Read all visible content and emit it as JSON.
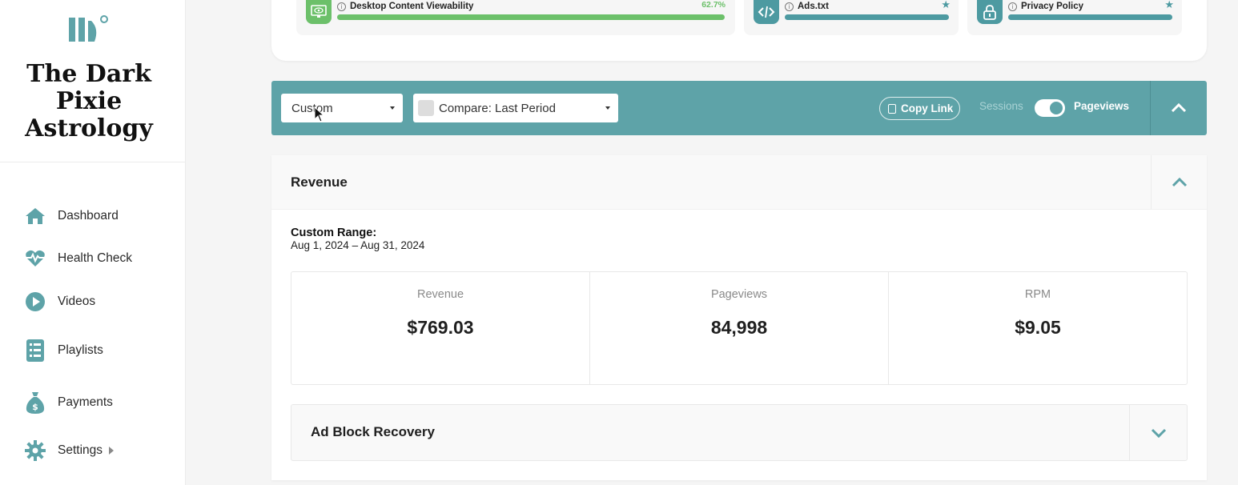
{
  "brand": {
    "site_title_lines": [
      "The Dark",
      "Pixie",
      "Astrology"
    ]
  },
  "sidebar": {
    "items": [
      {
        "label": "Dashboard",
        "icon": "home-icon"
      },
      {
        "label": "Health Check",
        "icon": "heartbeat-icon"
      },
      {
        "label": "Videos",
        "icon": "play-circle-icon"
      },
      {
        "label": "Playlists",
        "icon": "list-icon"
      },
      {
        "label": "Payments",
        "icon": "money-bag-icon"
      },
      {
        "label": "Settings",
        "icon": "gear-icon"
      }
    ]
  },
  "health_metrics": [
    {
      "label": "Desktop Content Viewability",
      "value": "62.7%",
      "progress_percent": 100,
      "icon": "monitor-eye-icon",
      "color": "#6cc06a"
    },
    {
      "label": "Ads.txt",
      "icon": "code-icon",
      "color": "#4d9aa1"
    },
    {
      "label": "Privacy Policy",
      "icon": "lock-icon",
      "color": "#4d9aa1"
    }
  ],
  "filters": {
    "range_select": "Custom",
    "compare_select": "Compare: Last Period",
    "copy_link": "Copy Link",
    "sessions_label": "Sessions",
    "pageviews_label": "Pageviews",
    "toggle_state": "Pageviews"
  },
  "revenue": {
    "title": "Revenue",
    "range_label": "Custom Range:",
    "range_dates": "Aug 1, 2024 – Aug 31, 2024",
    "stats": [
      {
        "label": "Revenue",
        "value": "$769.03"
      },
      {
        "label": "Pageviews",
        "value": "84,998"
      },
      {
        "label": "RPM",
        "value": "$9.05"
      }
    ]
  },
  "ad_block": {
    "title": "Ad Block Recovery"
  },
  "colors": {
    "accent": "#5ea3a8",
    "positive": "#6cc06a"
  }
}
